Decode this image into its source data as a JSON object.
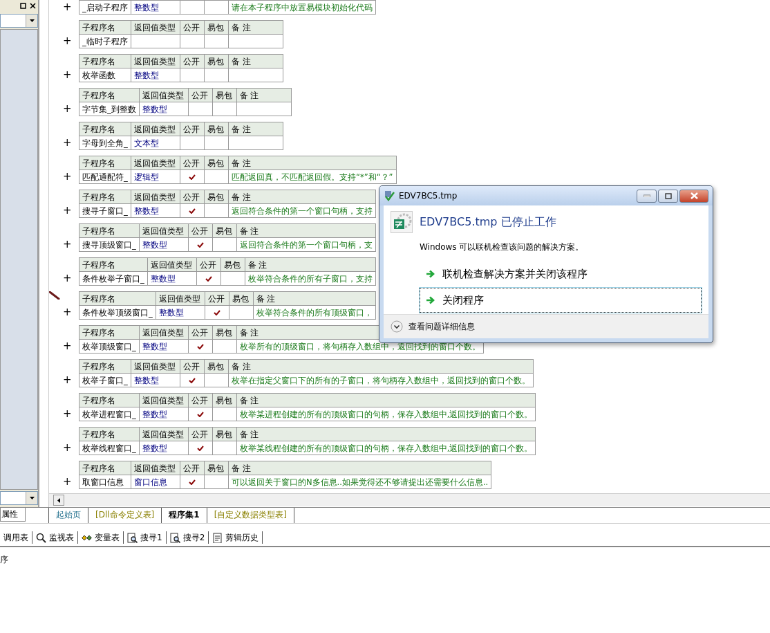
{
  "left_panel": {
    "tab": "属性"
  },
  "procedures": [
    {
      "toggle": "+",
      "marked": false,
      "name": "_启动子程序",
      "return_type": "整数型",
      "public": false,
      "remark": "请在本子程序中放置易模块初始化代码"
    },
    {
      "headers": [
        "子程序名",
        "返回值类型",
        "公开",
        "易包",
        "备 注"
      ],
      "toggle": "+",
      "marked": false,
      "name": "_临时子程序",
      "public": false
    },
    {
      "headers": [
        "子程序名",
        "返回值类型",
        "公开",
        "易包",
        "备 注"
      ],
      "toggle": "+",
      "marked": false,
      "name": "枚举函数",
      "return_type": "整数型",
      "public": false
    },
    {
      "headers": [
        "子程序名",
        "返回值类型",
        "公开",
        "易包",
        "备 注"
      ],
      "toggle": "+",
      "marked": false,
      "name": "字节集_到整数",
      "return_type": "整数型",
      "public": false
    },
    {
      "headers": [
        "子程序名",
        "返回值类型",
        "公开",
        "易包",
        "备 注"
      ],
      "toggle": "+",
      "marked": false,
      "name": "字母到全角_",
      "return_type": "文本型",
      "public": false
    },
    {
      "headers": [
        "子程序名",
        "返回值类型",
        "公开",
        "易包",
        "备 注"
      ],
      "toggle": "+",
      "marked": false,
      "name": "匹配通配符_",
      "return_type": "逻辑型",
      "public": true,
      "remark": "匹配返回真，不匹配返回假。支持“*”和“？”"
    },
    {
      "headers": [
        "子程序名",
        "返回值类型",
        "公开",
        "易包",
        "备 注"
      ],
      "toggle": "+",
      "marked": false,
      "name": "搜寻子窗口_",
      "return_type": "整数型",
      "public": true,
      "remark": "返回符合条件的第一个窗口句柄，支持"
    },
    {
      "headers": [
        "子程序名",
        "返回值类型",
        "公开",
        "易包",
        "备 注"
      ],
      "toggle": "+",
      "marked": false,
      "name": "搜寻顶级窗口_",
      "return_type": "整数型",
      "public": true,
      "remark": "返回符合条件的第一个窗口句柄，支"
    },
    {
      "headers": [
        "子程序名",
        "返回值类型",
        "公开",
        "易包",
        "备 注"
      ],
      "toggle": "+",
      "marked": false,
      "name": "条件枚举子窗口_",
      "return_type": "整数型",
      "public": true,
      "remark": "枚举符合条件的所有子窗口，支持"
    },
    {
      "headers": [
        "子程序名",
        "返回值类型",
        "公开",
        "易包",
        "备 注"
      ],
      "toggle": "+",
      "marked": true,
      "name": "条件枚举顶级窗口_",
      "return_type": "整数型",
      "public": true,
      "remark": "枚举符合条件的所有顶级窗口，"
    },
    {
      "headers": [
        "子程序名",
        "返回值类型",
        "公开",
        "易包",
        "备 注"
      ],
      "toggle": "+",
      "marked": false,
      "name": "枚举顶级窗口_",
      "return_type": "整数型",
      "public": true,
      "remark": "枚举所有的顶级窗口，将句柄存入数组中，返回找到的窗口个数。"
    },
    {
      "headers": [
        "子程序名",
        "返回值类型",
        "公开",
        "易包",
        "备 注"
      ],
      "toggle": "+",
      "marked": false,
      "name": "枚举子窗口_",
      "return_type": "整数型",
      "public": true,
      "remark": "枚举在指定父窗口下的所有的子窗口，将句柄存入数组中，返回找到的窗口个数。"
    },
    {
      "headers": [
        "子程序名",
        "返回值类型",
        "公开",
        "易包",
        "备 注"
      ],
      "toggle": "+",
      "marked": false,
      "name": "枚举进程窗口_",
      "return_type": "整数型",
      "public": true,
      "remark": "枚举某进程创建的所有的顶级窗口的句柄，保存入数组中,返回找到的窗口个数。"
    },
    {
      "headers": [
        "子程序名",
        "返回值类型",
        "公开",
        "易包",
        "备 注"
      ],
      "toggle": "+",
      "marked": false,
      "name": "枚举线程窗口_",
      "return_type": "整数型",
      "public": true,
      "remark": "枚举某线程创建的所有的顶级窗口的句柄，保存入数组中,返回找到的窗口个数。"
    },
    {
      "headers": [
        "子程序名",
        "返回值类型",
        "公开",
        "易包",
        "备 注"
      ],
      "toggle": "+",
      "marked": false,
      "name": "取窗口信息",
      "return_type": "窗口信息",
      "public": true,
      "remark": "可以返回关于窗口的N多信息..如果觉得还不够请提出还需要什么信息.."
    }
  ],
  "editor_tabs": [
    {
      "label": "起始页",
      "kind": "start",
      "selected": false
    },
    {
      "label": "[Dll命令定义表]",
      "kind": "table",
      "selected": false
    },
    {
      "label": "程序集1",
      "kind": "module",
      "selected": true
    },
    {
      "label": "[自定义数据类型表]",
      "kind": "table",
      "selected": false
    }
  ],
  "toolbar": [
    {
      "label": "调用表",
      "kind": "calls"
    },
    {
      "label": "监视表",
      "kind": "watch"
    },
    {
      "label": "变量表",
      "kind": "variables"
    },
    {
      "label": "搜寻1",
      "kind": "search"
    },
    {
      "label": "搜寻2",
      "kind": "search"
    },
    {
      "label": "剪辑历史",
      "kind": "history"
    }
  ],
  "output": {
    "text": "序"
  },
  "dialog": {
    "title": "EDV7BC5.tmp",
    "heading": "EDV7BC5.tmp 已停止工作",
    "message": "Windows 可以联机检查该问题的解决方案。",
    "options": [
      {
        "label": "联机检查解决方案并关闭该程序",
        "focused": false
      },
      {
        "label": "关闭程序",
        "focused": true
      }
    ],
    "details": "查看问题详细信息"
  }
}
